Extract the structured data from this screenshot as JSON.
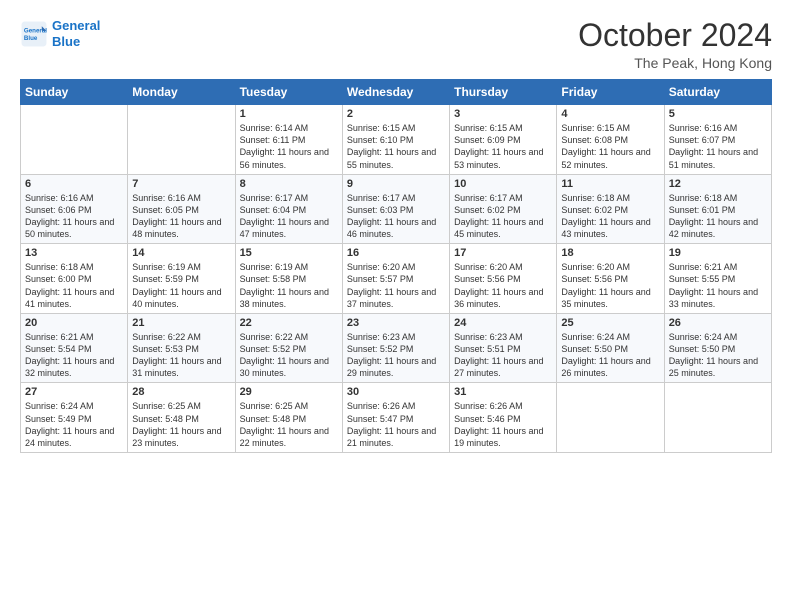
{
  "logo": {
    "line1": "General",
    "line2": "Blue"
  },
  "title": "October 2024",
  "location": "The Peak, Hong Kong",
  "header": {
    "days": [
      "Sunday",
      "Monday",
      "Tuesday",
      "Wednesday",
      "Thursday",
      "Friday",
      "Saturday"
    ]
  },
  "weeks": [
    [
      {
        "day": "",
        "sunrise": "",
        "sunset": "",
        "daylight": ""
      },
      {
        "day": "",
        "sunrise": "",
        "sunset": "",
        "daylight": ""
      },
      {
        "day": "1",
        "sunrise": "Sunrise: 6:14 AM",
        "sunset": "Sunset: 6:11 PM",
        "daylight": "Daylight: 11 hours and 56 minutes."
      },
      {
        "day": "2",
        "sunrise": "Sunrise: 6:15 AM",
        "sunset": "Sunset: 6:10 PM",
        "daylight": "Daylight: 11 hours and 55 minutes."
      },
      {
        "day": "3",
        "sunrise": "Sunrise: 6:15 AM",
        "sunset": "Sunset: 6:09 PM",
        "daylight": "Daylight: 11 hours and 53 minutes."
      },
      {
        "day": "4",
        "sunrise": "Sunrise: 6:15 AM",
        "sunset": "Sunset: 6:08 PM",
        "daylight": "Daylight: 11 hours and 52 minutes."
      },
      {
        "day": "5",
        "sunrise": "Sunrise: 6:16 AM",
        "sunset": "Sunset: 6:07 PM",
        "daylight": "Daylight: 11 hours and 51 minutes."
      }
    ],
    [
      {
        "day": "6",
        "sunrise": "Sunrise: 6:16 AM",
        "sunset": "Sunset: 6:06 PM",
        "daylight": "Daylight: 11 hours and 50 minutes."
      },
      {
        "day": "7",
        "sunrise": "Sunrise: 6:16 AM",
        "sunset": "Sunset: 6:05 PM",
        "daylight": "Daylight: 11 hours and 48 minutes."
      },
      {
        "day": "8",
        "sunrise": "Sunrise: 6:17 AM",
        "sunset": "Sunset: 6:04 PM",
        "daylight": "Daylight: 11 hours and 47 minutes."
      },
      {
        "day": "9",
        "sunrise": "Sunrise: 6:17 AM",
        "sunset": "Sunset: 6:03 PM",
        "daylight": "Daylight: 11 hours and 46 minutes."
      },
      {
        "day": "10",
        "sunrise": "Sunrise: 6:17 AM",
        "sunset": "Sunset: 6:02 PM",
        "daylight": "Daylight: 11 hours and 45 minutes."
      },
      {
        "day": "11",
        "sunrise": "Sunrise: 6:18 AM",
        "sunset": "Sunset: 6:02 PM",
        "daylight": "Daylight: 11 hours and 43 minutes."
      },
      {
        "day": "12",
        "sunrise": "Sunrise: 6:18 AM",
        "sunset": "Sunset: 6:01 PM",
        "daylight": "Daylight: 11 hours and 42 minutes."
      }
    ],
    [
      {
        "day": "13",
        "sunrise": "Sunrise: 6:18 AM",
        "sunset": "Sunset: 6:00 PM",
        "daylight": "Daylight: 11 hours and 41 minutes."
      },
      {
        "day": "14",
        "sunrise": "Sunrise: 6:19 AM",
        "sunset": "Sunset: 5:59 PM",
        "daylight": "Daylight: 11 hours and 40 minutes."
      },
      {
        "day": "15",
        "sunrise": "Sunrise: 6:19 AM",
        "sunset": "Sunset: 5:58 PM",
        "daylight": "Daylight: 11 hours and 38 minutes."
      },
      {
        "day": "16",
        "sunrise": "Sunrise: 6:20 AM",
        "sunset": "Sunset: 5:57 PM",
        "daylight": "Daylight: 11 hours and 37 minutes."
      },
      {
        "day": "17",
        "sunrise": "Sunrise: 6:20 AM",
        "sunset": "Sunset: 5:56 PM",
        "daylight": "Daylight: 11 hours and 36 minutes."
      },
      {
        "day": "18",
        "sunrise": "Sunrise: 6:20 AM",
        "sunset": "Sunset: 5:56 PM",
        "daylight": "Daylight: 11 hours and 35 minutes."
      },
      {
        "day": "19",
        "sunrise": "Sunrise: 6:21 AM",
        "sunset": "Sunset: 5:55 PM",
        "daylight": "Daylight: 11 hours and 33 minutes."
      }
    ],
    [
      {
        "day": "20",
        "sunrise": "Sunrise: 6:21 AM",
        "sunset": "Sunset: 5:54 PM",
        "daylight": "Daylight: 11 hours and 32 minutes."
      },
      {
        "day": "21",
        "sunrise": "Sunrise: 6:22 AM",
        "sunset": "Sunset: 5:53 PM",
        "daylight": "Daylight: 11 hours and 31 minutes."
      },
      {
        "day": "22",
        "sunrise": "Sunrise: 6:22 AM",
        "sunset": "Sunset: 5:52 PM",
        "daylight": "Daylight: 11 hours and 30 minutes."
      },
      {
        "day": "23",
        "sunrise": "Sunrise: 6:23 AM",
        "sunset": "Sunset: 5:52 PM",
        "daylight": "Daylight: 11 hours and 29 minutes."
      },
      {
        "day": "24",
        "sunrise": "Sunrise: 6:23 AM",
        "sunset": "Sunset: 5:51 PM",
        "daylight": "Daylight: 11 hours and 27 minutes."
      },
      {
        "day": "25",
        "sunrise": "Sunrise: 6:24 AM",
        "sunset": "Sunset: 5:50 PM",
        "daylight": "Daylight: 11 hours and 26 minutes."
      },
      {
        "day": "26",
        "sunrise": "Sunrise: 6:24 AM",
        "sunset": "Sunset: 5:50 PM",
        "daylight": "Daylight: 11 hours and 25 minutes."
      }
    ],
    [
      {
        "day": "27",
        "sunrise": "Sunrise: 6:24 AM",
        "sunset": "Sunset: 5:49 PM",
        "daylight": "Daylight: 11 hours and 24 minutes."
      },
      {
        "day": "28",
        "sunrise": "Sunrise: 6:25 AM",
        "sunset": "Sunset: 5:48 PM",
        "daylight": "Daylight: 11 hours and 23 minutes."
      },
      {
        "day": "29",
        "sunrise": "Sunrise: 6:25 AM",
        "sunset": "Sunset: 5:48 PM",
        "daylight": "Daylight: 11 hours and 22 minutes."
      },
      {
        "day": "30",
        "sunrise": "Sunrise: 6:26 AM",
        "sunset": "Sunset: 5:47 PM",
        "daylight": "Daylight: 11 hours and 21 minutes."
      },
      {
        "day": "31",
        "sunrise": "Sunrise: 6:26 AM",
        "sunset": "Sunset: 5:46 PM",
        "daylight": "Daylight: 11 hours and 19 minutes."
      },
      {
        "day": "",
        "sunrise": "",
        "sunset": "",
        "daylight": ""
      },
      {
        "day": "",
        "sunrise": "",
        "sunset": "",
        "daylight": ""
      }
    ]
  ]
}
